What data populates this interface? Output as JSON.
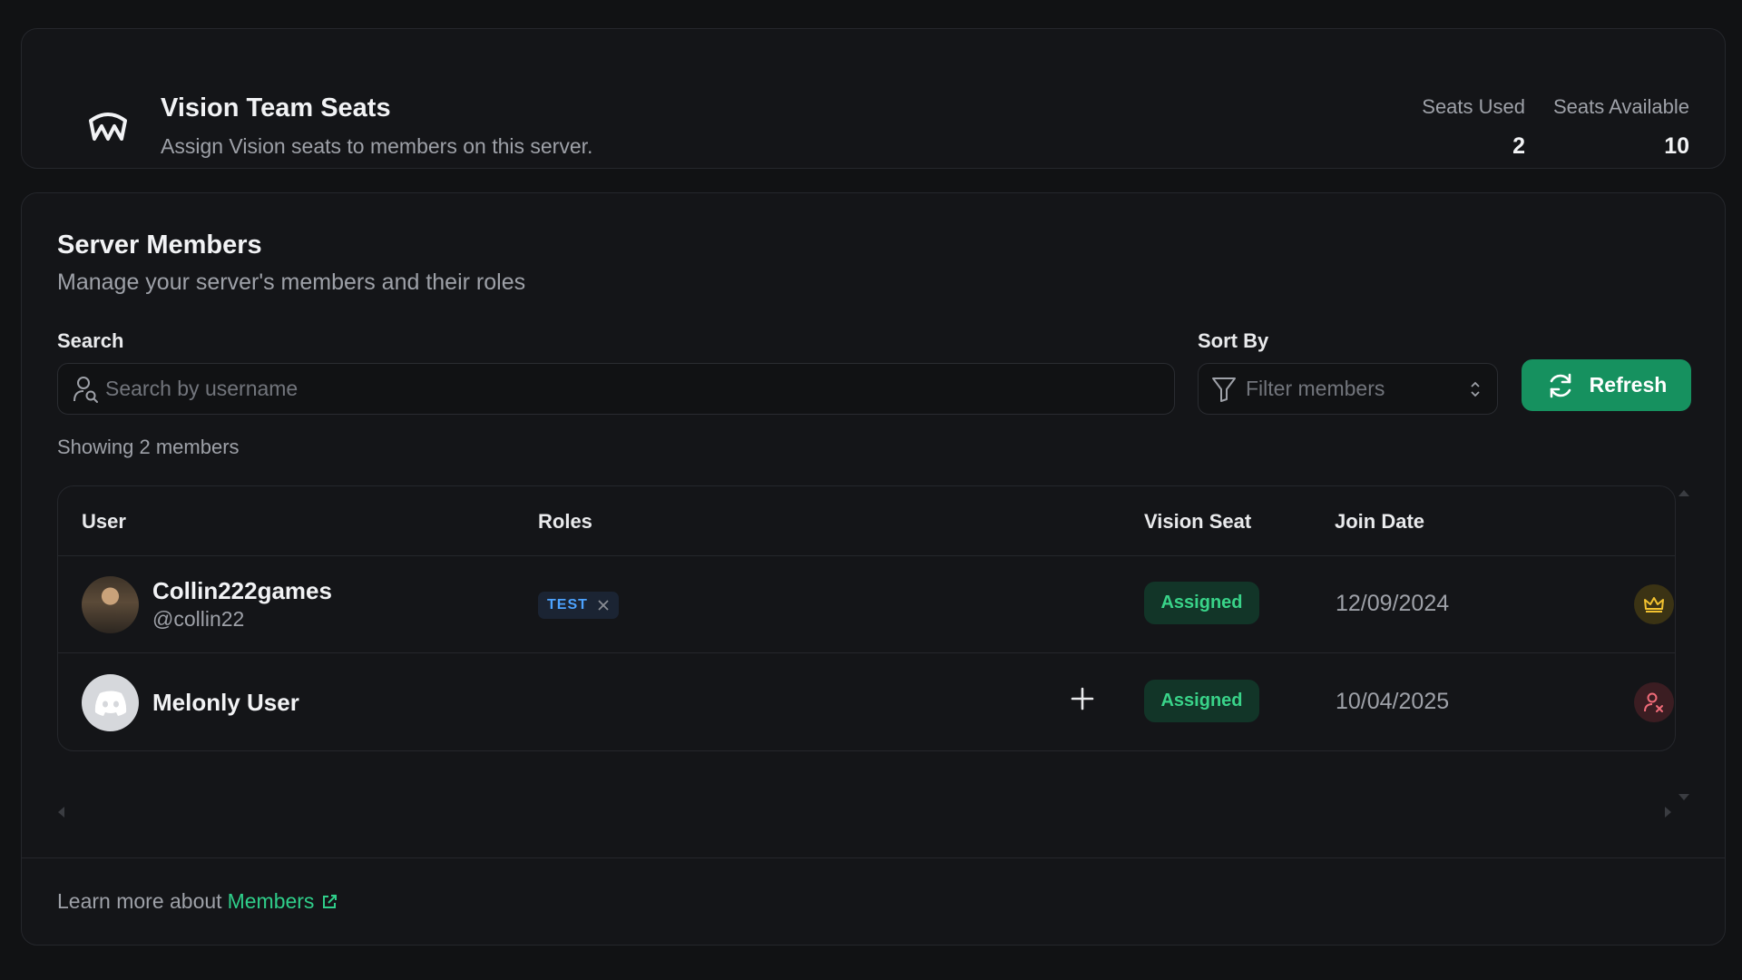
{
  "header": {
    "title": "Vision Team Seats",
    "subtitle": "Assign Vision seats to members on this server.",
    "seats_used_label": "Seats Used",
    "seats_used_value": "2",
    "seats_available_label": "Seats Available",
    "seats_available_value": "10"
  },
  "members": {
    "title": "Server Members",
    "subtitle": "Manage your server's members and their roles",
    "search_label": "Search",
    "search_placeholder": "Search by username",
    "sort_label": "Sort By",
    "sort_placeholder": "Filter members",
    "refresh_label": "Refresh",
    "showing_text": "Showing 2 members",
    "columns": [
      "User",
      "Roles",
      "Vision Seat",
      "Join Date"
    ],
    "rows": [
      {
        "username": "Collin222games",
        "handle": "@collin22",
        "avatar": "photo-avatar",
        "roles": [
          "TEST"
        ],
        "seat_status": "Assigned",
        "join_date": "12/09/2024",
        "action_icon": "crown-icon"
      },
      {
        "username": "Melonly User",
        "handle": "",
        "avatar": "discord-icon",
        "roles": [],
        "seat_status": "Assigned",
        "join_date": "10/04/2025",
        "action_icon": "user-remove-icon"
      }
    ]
  },
  "footer": {
    "text": "Learn more about",
    "link_label": "Members"
  },
  "colors": {
    "background": "#111214",
    "accent": "#16915f",
    "link": "#2fce8a",
    "badge_text": "#39d389",
    "role_text": "#4da3ff"
  }
}
